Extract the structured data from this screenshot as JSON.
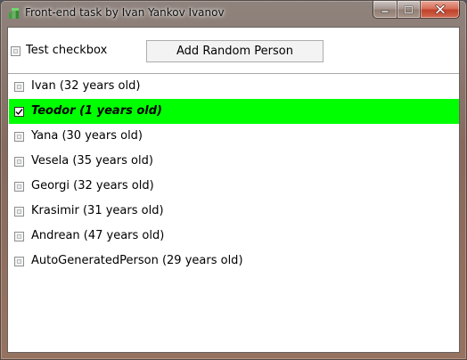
{
  "window": {
    "title": "Front-end task by Ivan Yankov Ivanov",
    "buttons": {
      "minimize": "minimize",
      "maximize": "maximize",
      "close": "close"
    }
  },
  "toolbar": {
    "test_checkbox_label": "Test checkbox",
    "test_checkbox_checked": false,
    "add_button_label": "Add Random Person"
  },
  "people": [
    {
      "label": "Ivan (32 years old)",
      "checked": false,
      "selected": false
    },
    {
      "label": "Teodor (1 years old)",
      "checked": true,
      "selected": true
    },
    {
      "label": "Yana (30 years old)",
      "checked": false,
      "selected": false
    },
    {
      "label": "Vesela (35 years old)",
      "checked": false,
      "selected": false
    },
    {
      "label": "Georgi (32 years old)",
      "checked": false,
      "selected": false
    },
    {
      "label": "Krasimir (31 years old)",
      "checked": false,
      "selected": false
    },
    {
      "label": "Andrean (47 years old)",
      "checked": false,
      "selected": false
    },
    {
      "label": "AutoGeneratedPerson (29 years old)",
      "checked": false,
      "selected": false
    }
  ],
  "colors": {
    "selection": "#00ff00"
  }
}
